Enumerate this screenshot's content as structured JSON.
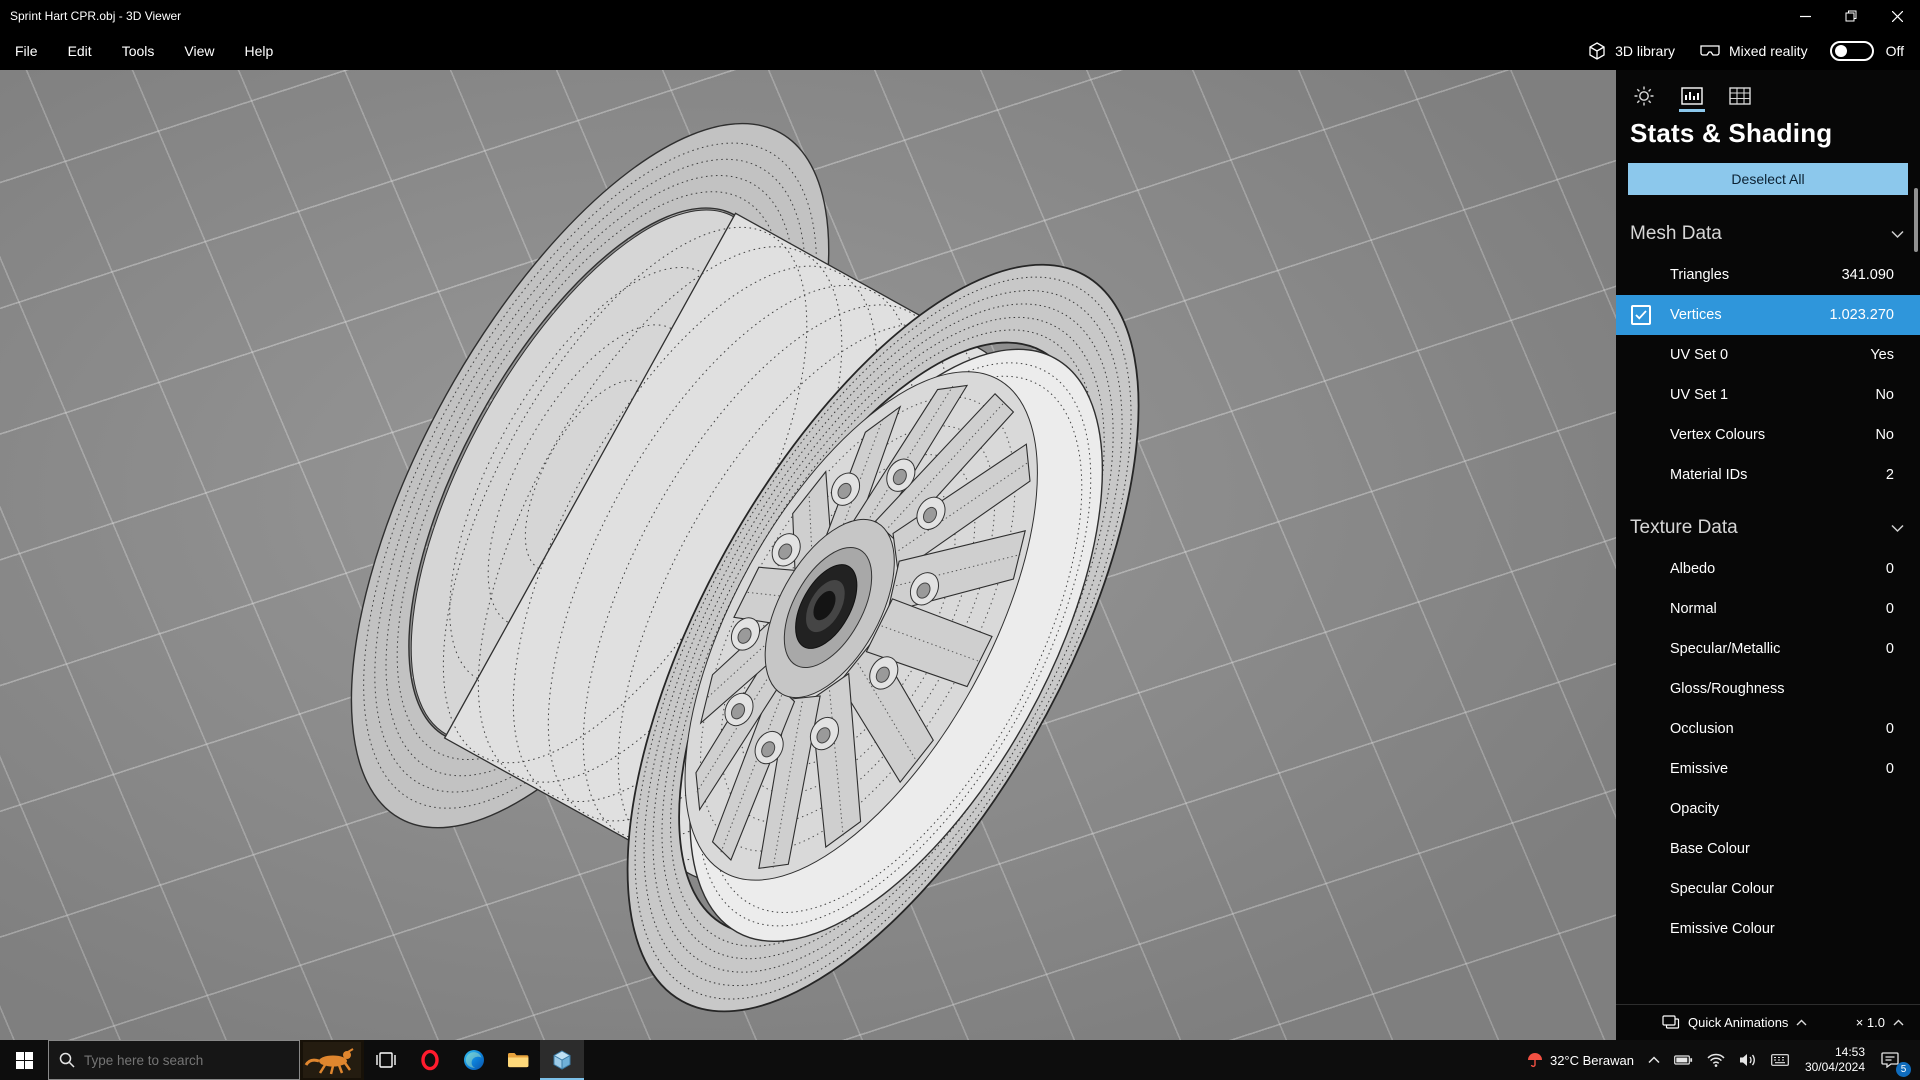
{
  "window": {
    "title": "Sprint Hart CPR.obj - 3D Viewer",
    "menu": [
      "File",
      "Edit",
      "Tools",
      "View",
      "Help"
    ],
    "library_label": "3D library",
    "mixed_reality_label": "Mixed reality",
    "mixed_reality_state": "Off"
  },
  "panel": {
    "title": "Stats & Shading",
    "deselect_label": "Deselect All",
    "sections": [
      {
        "title": "Mesh Data",
        "rows": [
          {
            "label": "Triangles",
            "value": "341.090"
          },
          {
            "label": "Vertices",
            "value": "1.023.270",
            "selected": true
          },
          {
            "label": "UV Set 0",
            "value": "Yes"
          },
          {
            "label": "UV Set 1",
            "value": "No"
          },
          {
            "label": "Vertex Colours",
            "value": "No"
          },
          {
            "label": "Material IDs",
            "value": "2"
          }
        ]
      },
      {
        "title": "Texture Data",
        "rows": [
          {
            "label": "Albedo",
            "value": "0"
          },
          {
            "label": "Normal",
            "value": "0"
          },
          {
            "label": "Specular/Metallic",
            "value": "0"
          },
          {
            "label": "Gloss/Roughness",
            "value": ""
          },
          {
            "label": "Occlusion",
            "value": "0"
          },
          {
            "label": "Emissive",
            "value": "0"
          },
          {
            "label": "Opacity",
            "value": ""
          },
          {
            "label": "Base Colour",
            "value": ""
          },
          {
            "label": "Specular Colour",
            "value": ""
          },
          {
            "label": "Emissive Colour",
            "value": ""
          }
        ]
      }
    ],
    "quick_animations_label": "Quick Animations",
    "speed_label": "× 1.0"
  },
  "taskbar": {
    "search_placeholder": "Type here to search",
    "weather": "32°C Berawan",
    "time": "14:53",
    "date": "30/04/2024",
    "notification_badge": "5"
  },
  "colors": {
    "accent": "#2f96db",
    "accent_light": "#8cc8ec",
    "viewport_bg": "#8d8d8d"
  }
}
